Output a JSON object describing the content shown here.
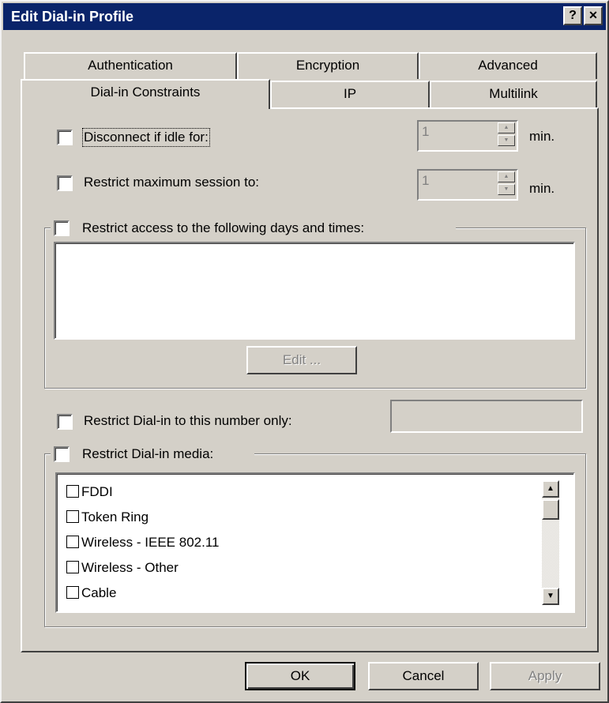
{
  "window": {
    "title": "Edit Dial-in Profile",
    "help_glyph": "?",
    "close_glyph": "✕"
  },
  "tabs": {
    "back_row": [
      "Authentication",
      "Encryption",
      "Advanced"
    ],
    "front_row": [
      "Dial-in Constraints",
      "IP",
      "Multilink"
    ],
    "active": "Dial-in Constraints"
  },
  "constraints": {
    "idle": {
      "label": "Disconnect if idle for:",
      "value": "1",
      "unit": "min.",
      "checked": false
    },
    "max_session": {
      "label": "Restrict maximum session to:",
      "value": "1",
      "unit": "min.",
      "checked": false
    },
    "days_times": {
      "label": "Restrict access to the following days and times:",
      "checked": false,
      "edit_label": "Edit ..."
    },
    "number_only": {
      "label": "Restrict Dial-in to this number only:",
      "value": "",
      "checked": false
    },
    "media": {
      "label": "Restrict Dial-in media:",
      "checked": false,
      "items": [
        "FDDI",
        "Token Ring",
        "Wireless - IEEE 802.11",
        "Wireless - Other",
        "Cable"
      ]
    }
  },
  "buttons": {
    "ok": "OK",
    "cancel": "Cancel",
    "apply": "Apply"
  },
  "icons": {
    "scroll_up": "▲",
    "scroll_down": "▼"
  }
}
